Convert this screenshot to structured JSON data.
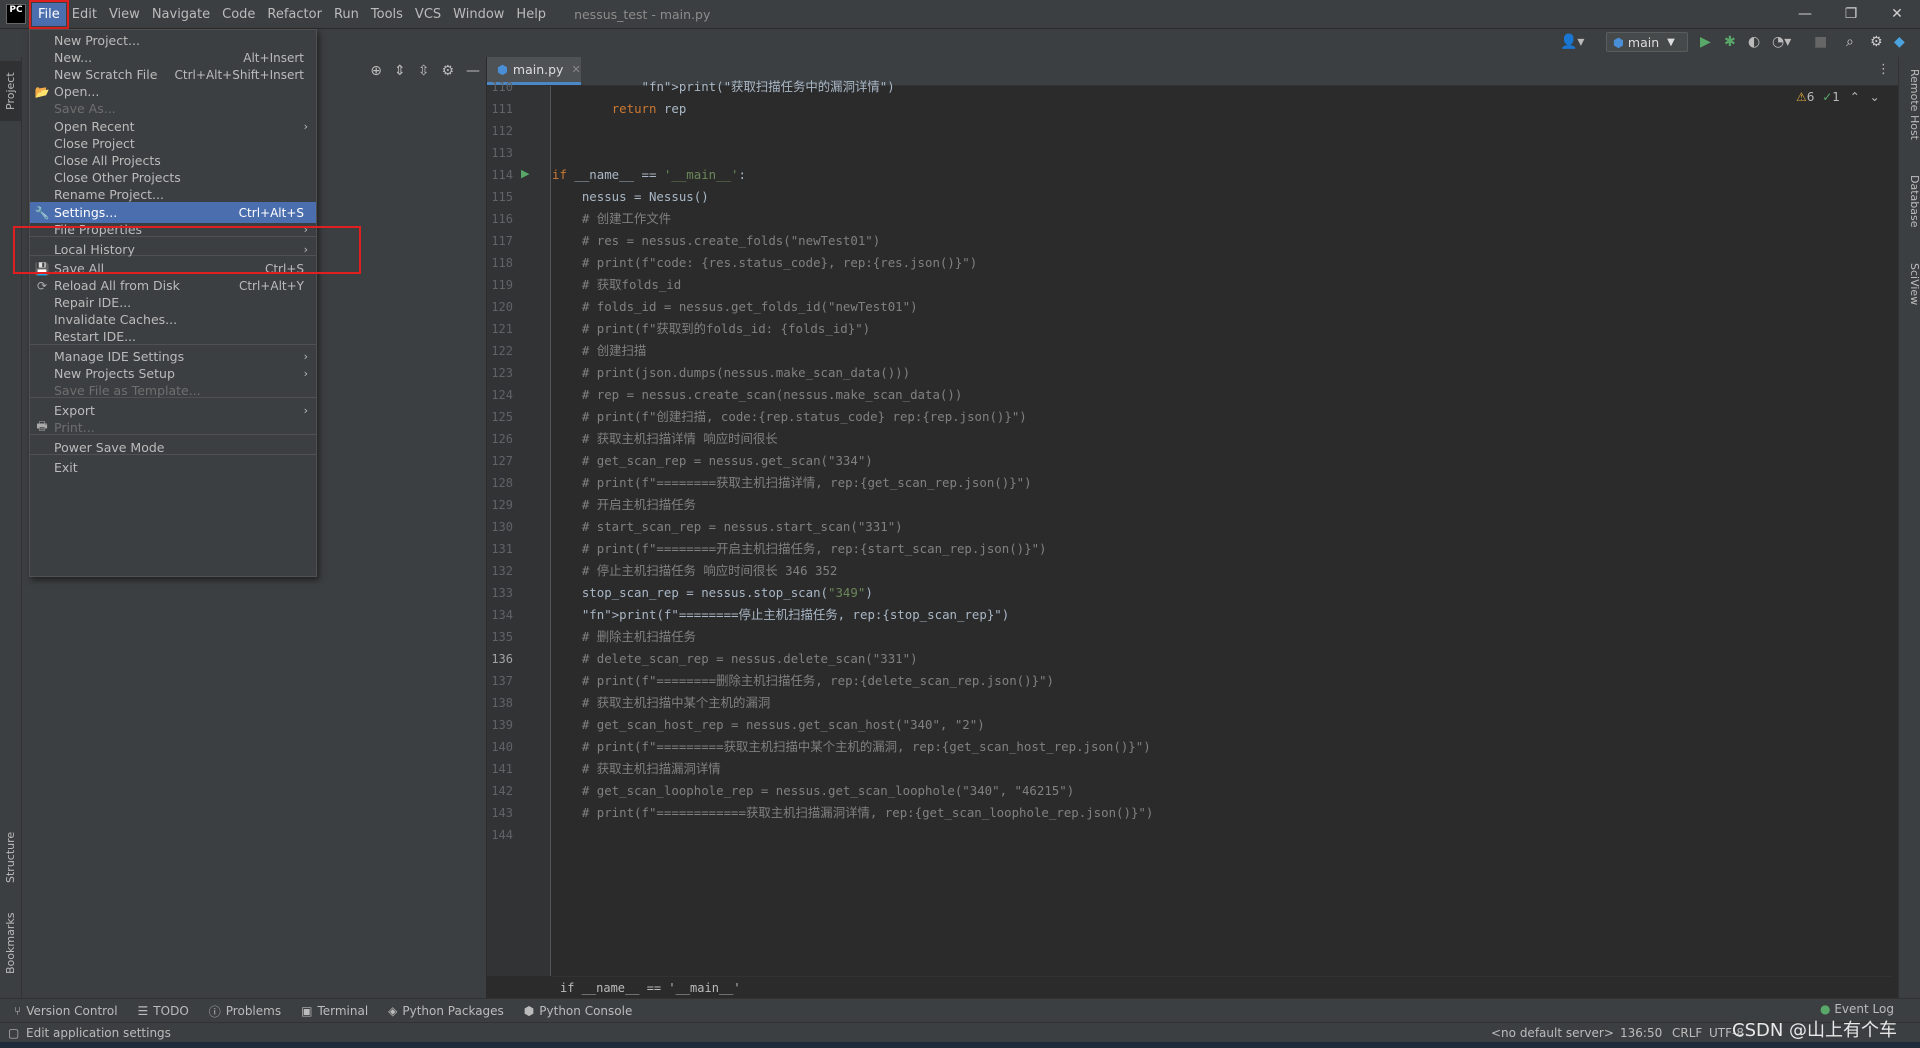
{
  "window": {
    "title": "nessus_test - main.py",
    "logo": "PC"
  },
  "menubar": [
    "File",
    "Edit",
    "View",
    "Navigate",
    "Code",
    "Refactor",
    "Run",
    "Tools",
    "VCS",
    "Window",
    "Help"
  ],
  "toolbar": {
    "run_config": "main"
  },
  "left_tabs": {
    "project": "Project",
    "structure": "Structure",
    "bookmarks": "Bookmarks"
  },
  "right_tabs": {
    "remote_host": "Remote Host",
    "database": "Database",
    "sciview": "SciView"
  },
  "editor": {
    "tab": "main.py",
    "inspection": {
      "warnings": "6",
      "ok": "1"
    },
    "breadcrumb": "if __name__ == '__main__'",
    "lines": [
      {
        "n": "110",
        "t": "            print(\"获取扫描任务中的漏洞详情\")",
        "k": "print"
      },
      {
        "n": "111",
        "t": "        return rep",
        "k": "return"
      },
      {
        "n": "112",
        "t": "",
        "k": "plain"
      },
      {
        "n": "113",
        "t": "",
        "k": "plain"
      },
      {
        "n": "114",
        "t": "if __name__ == '__main__':",
        "k": "main"
      },
      {
        "n": "115",
        "t": "    nessus = Nessus()",
        "k": "plain"
      },
      {
        "n": "116",
        "t": "    # 创建工作文件",
        "k": "cm"
      },
      {
        "n": "117",
        "t": "    # res = nessus.create_folds(\"newTest01\")",
        "k": "cm"
      },
      {
        "n": "118",
        "t": "    # print(f\"code: {res.status_code}, rep:{res.json()}\")",
        "k": "cm"
      },
      {
        "n": "119",
        "t": "    # 获取folds_id",
        "k": "cm"
      },
      {
        "n": "120",
        "t": "    # folds_id = nessus.get_folds_id(\"newTest01\")",
        "k": "cm"
      },
      {
        "n": "121",
        "t": "    # print(f\"获取到的folds_id: {folds_id}\")",
        "k": "cm"
      },
      {
        "n": "122",
        "t": "    # 创建扫描",
        "k": "cm"
      },
      {
        "n": "123",
        "t": "    # print(json.dumps(nessus.make_scan_data()))",
        "k": "cm"
      },
      {
        "n": "124",
        "t": "    # rep = nessus.create_scan(nessus.make_scan_data())",
        "k": "cm"
      },
      {
        "n": "125",
        "t": "    # print(f\"创建扫描, code:{rep.status_code} rep:{rep.json()}\")",
        "k": "cm"
      },
      {
        "n": "126",
        "t": "    # 获取主机扫描详情 响应时间很长",
        "k": "cm"
      },
      {
        "n": "127",
        "t": "    # get_scan_rep = nessus.get_scan(\"334\")",
        "k": "cm"
      },
      {
        "n": "128",
        "t": "    # print(f\"========获取主机扫描详情, rep:{get_scan_rep.json()}\")",
        "k": "cm"
      },
      {
        "n": "129",
        "t": "    # 开启主机扫描任务",
        "k": "cm"
      },
      {
        "n": "130",
        "t": "    # start_scan_rep = nessus.start_scan(\"331\")",
        "k": "cm"
      },
      {
        "n": "131",
        "t": "    # print(f\"========开启主机扫描任务, rep:{start_scan_rep.json()}\")",
        "k": "cm"
      },
      {
        "n": "132",
        "t": "    # 停止主机扫描任务 响应时间很长 346 352",
        "k": "cm"
      },
      {
        "n": "133",
        "t": "    stop_scan_rep = nessus.stop_scan(\"349\")",
        "k": "stop"
      },
      {
        "n": "134",
        "t": "    print(f\"========停止主机扫描任务, rep:{stop_scan_rep}\")",
        "k": "print2"
      },
      {
        "n": "135",
        "t": "    # 删除主机扫描任务",
        "k": "cm"
      },
      {
        "n": "136",
        "t": "    # delete_scan_rep = nessus.delete_scan(\"331\")",
        "k": "cm"
      },
      {
        "n": "137",
        "t": "    # print(f\"========删除主机扫描任务, rep:{delete_scan_rep.json()}\")",
        "k": "cm"
      },
      {
        "n": "138",
        "t": "    # 获取主机扫描中某个主机的漏洞",
        "k": "cm"
      },
      {
        "n": "139",
        "t": "    # get_scan_host_rep = nessus.get_scan_host(\"340\", \"2\")",
        "k": "cm"
      },
      {
        "n": "140",
        "t": "    # print(f\"=========获取主机扫描中某个主机的漏洞, rep:{get_scan_host_rep.json()}\")",
        "k": "cm"
      },
      {
        "n": "141",
        "t": "    # 获取主机扫描漏洞详情",
        "k": "cm"
      },
      {
        "n": "142",
        "t": "    # get_scan_loophole_rep = nessus.get_scan_loophole(\"340\", \"46215\")",
        "k": "cm"
      },
      {
        "n": "143",
        "t": "    # print(f\"============获取主机扫描漏洞详情, rep:{get_scan_loophole_rep.json()}\")",
        "k": "cm"
      },
      {
        "n": "144",
        "t": "",
        "k": "plain"
      }
    ]
  },
  "file_menu": [
    {
      "label": "New Project...",
      "shortcut": "",
      "dis": false,
      "sub": false,
      "sel": false,
      "icon": ""
    },
    {
      "label": "New...",
      "shortcut": "Alt+Insert",
      "dis": false,
      "sub": false,
      "sel": false,
      "icon": ""
    },
    {
      "label": "New Scratch File",
      "shortcut": "Ctrl+Alt+Shift+Insert",
      "dis": false,
      "sub": false,
      "sel": false,
      "icon": ""
    },
    {
      "label": "Open...",
      "shortcut": "",
      "dis": false,
      "sub": false,
      "sel": false,
      "icon": "📂"
    },
    {
      "label": "Save As...",
      "shortcut": "",
      "dis": true,
      "sub": false,
      "sel": false,
      "icon": ""
    },
    {
      "label": "Open Recent",
      "shortcut": "",
      "dis": false,
      "sub": true,
      "sel": false,
      "icon": ""
    },
    {
      "label": "Close Project",
      "shortcut": "",
      "dis": false,
      "sub": false,
      "sel": false,
      "icon": ""
    },
    {
      "label": "Close All Projects",
      "shortcut": "",
      "dis": false,
      "sub": false,
      "sel": false,
      "icon": ""
    },
    {
      "label": "Close Other Projects",
      "shortcut": "",
      "dis": false,
      "sub": false,
      "sel": false,
      "icon": ""
    },
    {
      "label": "Rename Project...",
      "shortcut": "",
      "dis": false,
      "sub": false,
      "sel": false,
      "icon": ""
    },
    {
      "label": "Settings...",
      "shortcut": "Ctrl+Alt+S",
      "dis": false,
      "sub": false,
      "sel": true,
      "icon": "🔧"
    },
    {
      "label": "File Properties",
      "shortcut": "",
      "dis": false,
      "sub": true,
      "sel": false,
      "icon": ""
    },
    {
      "label": "Local History",
      "shortcut": "",
      "dis": false,
      "sub": true,
      "sel": false,
      "icon": ""
    },
    {
      "label": "Save All",
      "shortcut": "Ctrl+S",
      "dis": false,
      "sub": false,
      "sel": false,
      "icon": "💾"
    },
    {
      "label": "Reload All from Disk",
      "shortcut": "Ctrl+Alt+Y",
      "dis": false,
      "sub": false,
      "sel": false,
      "icon": "⟳"
    },
    {
      "label": "Repair IDE...",
      "shortcut": "",
      "dis": false,
      "sub": false,
      "sel": false,
      "icon": ""
    },
    {
      "label": "Invalidate Caches...",
      "shortcut": "",
      "dis": false,
      "sub": false,
      "sel": false,
      "icon": ""
    },
    {
      "label": "Restart IDE...",
      "shortcut": "",
      "dis": false,
      "sub": false,
      "sel": false,
      "icon": ""
    },
    {
      "label": "Manage IDE Settings",
      "shortcut": "",
      "dis": false,
      "sub": true,
      "sel": false,
      "icon": ""
    },
    {
      "label": "New Projects Setup",
      "shortcut": "",
      "dis": false,
      "sub": true,
      "sel": false,
      "icon": ""
    },
    {
      "label": "Save File as Template...",
      "shortcut": "",
      "dis": true,
      "sub": false,
      "sel": false,
      "icon": ""
    },
    {
      "label": "Export",
      "shortcut": "",
      "dis": false,
      "sub": true,
      "sel": false,
      "icon": ""
    },
    {
      "label": "Print...",
      "shortcut": "",
      "dis": true,
      "sub": false,
      "sel": false,
      "icon": "🖶"
    },
    {
      "label": "Power Save Mode",
      "shortcut": "",
      "dis": false,
      "sub": false,
      "sel": false,
      "icon": ""
    },
    {
      "label": "Exit",
      "shortcut": "",
      "dis": false,
      "sub": false,
      "sel": false,
      "icon": ""
    }
  ],
  "toolwindows": [
    "Version Control",
    "TODO",
    "Problems",
    "Terminal",
    "Python Packages",
    "Python Console"
  ],
  "event_log": "Event Log",
  "status": {
    "message": "Edit application settings",
    "server": "<no default server>",
    "position": "136:50",
    "line_sep": "CRLF",
    "encoding": "UTF-8"
  },
  "watermark": "CSDN @山上有个车"
}
